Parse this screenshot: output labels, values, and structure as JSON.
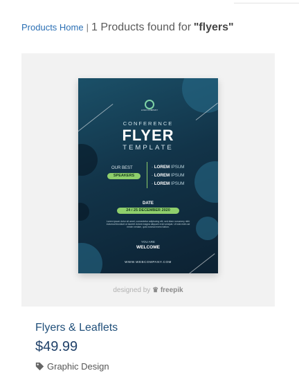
{
  "breadcrumb": {
    "home_label": "Products Home",
    "separator": "|",
    "results_text": "1 Products found for",
    "query": "\"flyers\""
  },
  "product": {
    "title": "Flyers & Leaflets",
    "price": "$49.99",
    "category": "Graphic Design",
    "category_icon": "tag-icon"
  },
  "image": {
    "attribution_prefix": "designed by",
    "attribution_brand": "freepik",
    "poster": {
      "logo_text": "LOGO COMPANY",
      "heading_top": "CONFERENCE",
      "heading_main": "FLYER",
      "heading_sub": "TEMPLATE",
      "our_best": "OUR BEST",
      "speakers": "SPEAKERS",
      "items": [
        {
          "bold": "LOREM",
          "light": "IPSUM"
        },
        {
          "bold": "LOREM",
          "light": "IPSUM"
        },
        {
          "bold": "LOREM",
          "light": "IPSUM"
        }
      ],
      "date_label": "DATE",
      "date_value": "24 / 25 DECEMBER 2020",
      "body_text": "Lorem ipsum dolor sit amet, consectetur adipiscing elit, sed diam nonummy nibh euismod tincidunt ut laoreet dolore magna aliquam erat volutpat. Ut wisi enim ad minim veniam, quis nostrud exerci tation.",
      "you_are": "YOU ARE",
      "welcome": "WELCOME",
      "website": "WWW.WEBCOMPANY.COM"
    }
  },
  "colors": {
    "link": "#2a6fb4",
    "title": "#1f4e79",
    "price": "#1f4068",
    "poster_bg": "#123449",
    "poster_accent": "#8fcf6c"
  }
}
